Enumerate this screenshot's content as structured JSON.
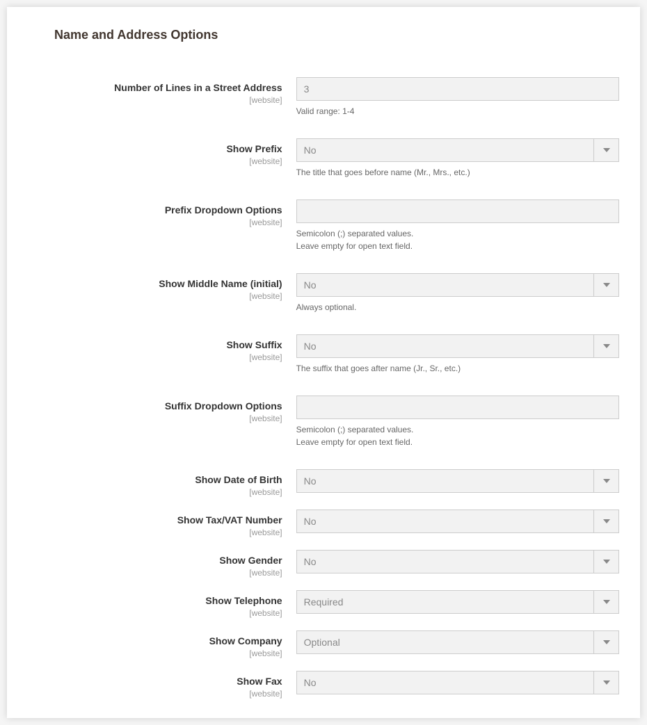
{
  "section_title": "Name and Address Options",
  "scope_label": "[website]",
  "fields": {
    "lines": {
      "label": "Number of Lines in a Street Address",
      "value": "3",
      "help": "Valid range: 1-4"
    },
    "show_prefix": {
      "label": "Show Prefix",
      "value": "No",
      "help": "The title that goes before name (Mr., Mrs., etc.)"
    },
    "prefix_options": {
      "label": "Prefix Dropdown Options",
      "value": "",
      "help1": "Semicolon (;) separated values.",
      "help2": "Leave empty for open text field."
    },
    "middle_name": {
      "label": "Show Middle Name (initial)",
      "value": "No",
      "help": "Always optional."
    },
    "show_suffix": {
      "label": "Show Suffix",
      "value": "No",
      "help": "The suffix that goes after name (Jr., Sr., etc.)"
    },
    "suffix_options": {
      "label": "Suffix Dropdown Options",
      "value": "",
      "help1": "Semicolon (;) separated values.",
      "help2": "Leave empty for open text field."
    },
    "dob": {
      "label": "Show Date of Birth",
      "value": "No"
    },
    "tax": {
      "label": "Show Tax/VAT Number",
      "value": "No"
    },
    "gender": {
      "label": "Show Gender",
      "value": "No"
    },
    "telephone": {
      "label": "Show Telephone",
      "value": "Required"
    },
    "company": {
      "label": "Show Company",
      "value": "Optional"
    },
    "fax": {
      "label": "Show Fax",
      "value": "No"
    }
  }
}
